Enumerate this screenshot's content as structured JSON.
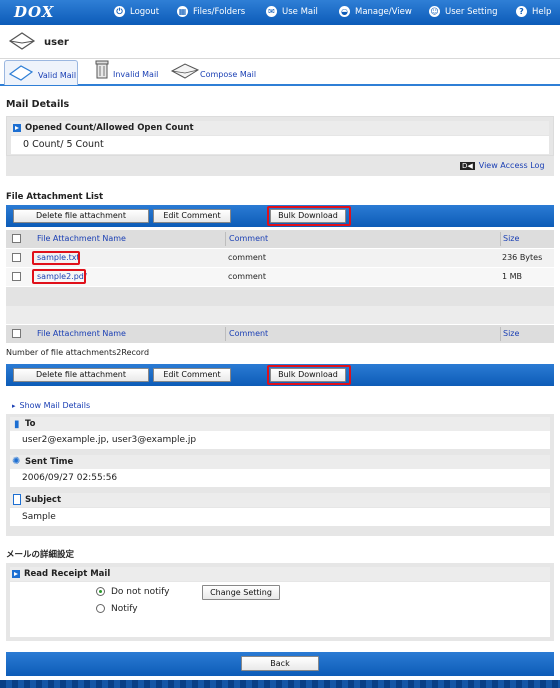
{
  "app": {
    "logo": "DOX"
  },
  "nav": [
    {
      "label": "Logout",
      "icon": "logout-icon"
    },
    {
      "label": "Files/Folders",
      "icon": "folders-icon"
    },
    {
      "label": "Use Mail",
      "icon": "mail-icon"
    },
    {
      "label": "Manage/View",
      "icon": "manage-icon"
    },
    {
      "label": "User Setting",
      "icon": "user-setting-icon"
    },
    {
      "label": "Help",
      "icon": "help-icon"
    }
  ],
  "user": {
    "name": "user"
  },
  "tabs": [
    {
      "label": "Valid Mail",
      "active": true
    },
    {
      "label": "Invalid Mail",
      "active": false
    },
    {
      "label": "Compose Mail",
      "active": false
    }
  ],
  "mail_details": {
    "title": "Mail Details",
    "open_count_label": "Opened Count/Allowed Open Count",
    "open_count_value": "0 Count/ 5 Count",
    "view_access_log": "View Access Log"
  },
  "attachments": {
    "title": "File Attachment List",
    "buttons": {
      "delete": "Delete file attachment",
      "edit": "Edit Comment",
      "bulk": "Bulk Download"
    },
    "columns": {
      "name": "File Attachment Name",
      "comment": "Comment",
      "size": "Size"
    },
    "rows": [
      {
        "name": "sample.txt",
        "comment": "comment",
        "size": "236 Bytes"
      },
      {
        "name": "sample2.pdf",
        "comment": "comment",
        "size": "1 MB"
      }
    ],
    "count_text": "Number of file attachments2Record"
  },
  "details": {
    "show_link": "Show Mail Details",
    "to_label": "To",
    "to_value": "user2@example.jp, user3@example.jp",
    "sent_label": "Sent Time",
    "sent_value": "2006/09/27 02:55:56",
    "subject_label": "Subject",
    "subject_value": "Sample"
  },
  "advanced": {
    "title": "メールの詳細設定",
    "receipt_label": "Read Receipt Mail",
    "option_no": "Do not notify",
    "option_yes": "Notify",
    "selected": "Do not notify",
    "change_button": "Change Setting"
  },
  "footer": {
    "back_button": "Back"
  },
  "colors": {
    "brand_blue": "#0c5bb8",
    "highlight_red": "#e0101a"
  }
}
